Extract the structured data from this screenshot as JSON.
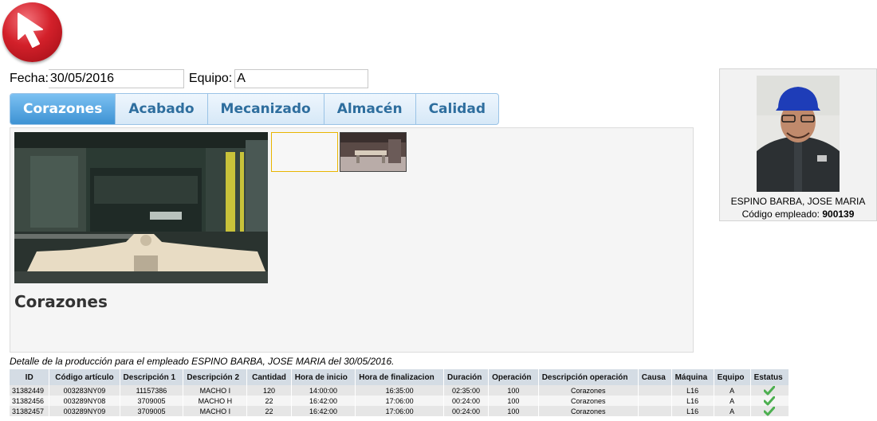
{
  "back_button": {
    "icon": "arrow-cursor-icon"
  },
  "filters": {
    "fecha_label": "Fecha:",
    "fecha_value": "30/05/2016",
    "equipo_label": "Equipo:",
    "equipo_value": "A"
  },
  "tabs": [
    {
      "label": "Corazones"
    },
    {
      "label": "Acabado"
    },
    {
      "label": "Mecanizado"
    },
    {
      "label": "Almacén"
    },
    {
      "label": "Calidad"
    }
  ],
  "panel": {
    "title": "Corazones"
  },
  "employee": {
    "name": "ESPINO BARBA, JOSE MARIA",
    "code_label": "Código empleado:",
    "code": "900139"
  },
  "detail_text": "Detalle de la producción para el empleado ESPINO BARBA, JOSE MARIA del 30/05/2016.",
  "table": {
    "headers": [
      "ID",
      "Código artículo",
      "Descripción 1",
      "Descripción 2",
      "Cantidad",
      "Hora de inicio",
      "Hora de finalizacion",
      "Duración",
      "Operación",
      "Descripción operación",
      "Causa",
      "Máquina",
      "Equipo",
      "Estatus"
    ],
    "rows": [
      [
        "31382449",
        "003283NY09",
        "11157386",
        "MACHO I",
        "120",
        "14:00:00",
        "16:35:00",
        "02:35:00",
        "100",
        "Corazones",
        "",
        "L16",
        "A"
      ],
      [
        "31382456",
        "003289NY08",
        "3709005",
        "MACHO H",
        "22",
        "16:42:00",
        "17:06:00",
        "00:24:00",
        "100",
        "Corazones",
        "",
        "L16",
        "A"
      ],
      [
        "31382457",
        "003289NY09",
        "3709005",
        "MACHO I",
        "22",
        "16:42:00",
        "17:06:00",
        "00:24:00",
        "100",
        "Corazones",
        "",
        "L16",
        "A"
      ]
    ],
    "status_icon": "check-icon",
    "status_color": "#4caf50"
  },
  "colors": {
    "tab_active": "#3d92d3",
    "tab_text": "#2e6e9e",
    "back_button": "#d3202a"
  }
}
